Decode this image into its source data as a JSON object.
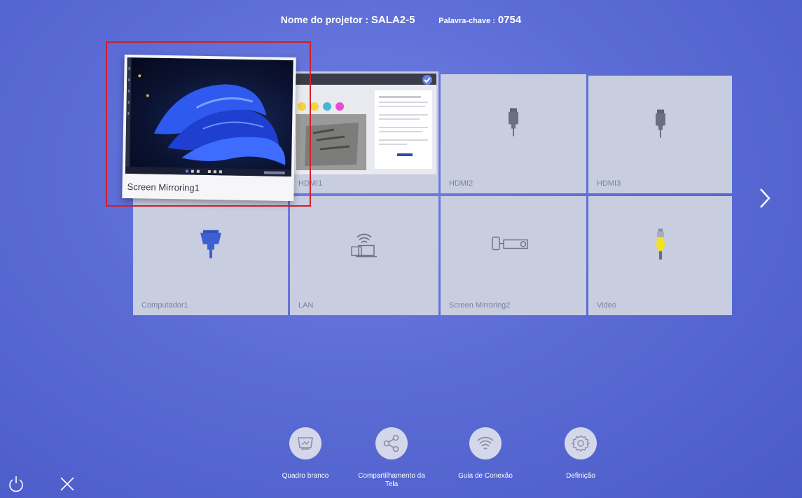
{
  "header": {
    "projector_label": "Nome do projetor :",
    "projector_name": "SALA2-5",
    "keyword_label": "Palavra-chave :",
    "keyword_value": "0754"
  },
  "sources": [
    {
      "label": "Screen Mirroring1",
      "icon": "windows-desktop-thumbnail",
      "highlighted": true
    },
    {
      "label": "HDMI1",
      "icon": "presentation-thumbnail",
      "selected": true
    },
    {
      "label": "HDMI2",
      "icon": "hdmi-plug-icon"
    },
    {
      "label": "HDMI3",
      "icon": "hdmi-plug-icon"
    },
    {
      "label": "Computador1",
      "icon": "vga-plug-icon"
    },
    {
      "label": "LAN",
      "icon": "lan-wifi-laptop-icon"
    },
    {
      "label": "Screen Mirroring2",
      "icon": "phone-projector-icon"
    },
    {
      "label": "Video",
      "icon": "rca-yellow-plug-icon"
    }
  ],
  "bottom_bar": [
    {
      "label": "Quadro branco",
      "icon": "whiteboard-icon"
    },
    {
      "label_line1": "Compartilhamento da",
      "label_line2": "Tela",
      "icon": "share-icon"
    },
    {
      "label": "Guia de Conexão",
      "icon": "wifi-guide-icon"
    },
    {
      "label": "Definição",
      "icon": "gear-icon"
    }
  ],
  "colors": {
    "background": "#5b6cd6",
    "tile": "#c8cde0",
    "highlight": "#d21e2a",
    "check": "#6b7fe8"
  }
}
